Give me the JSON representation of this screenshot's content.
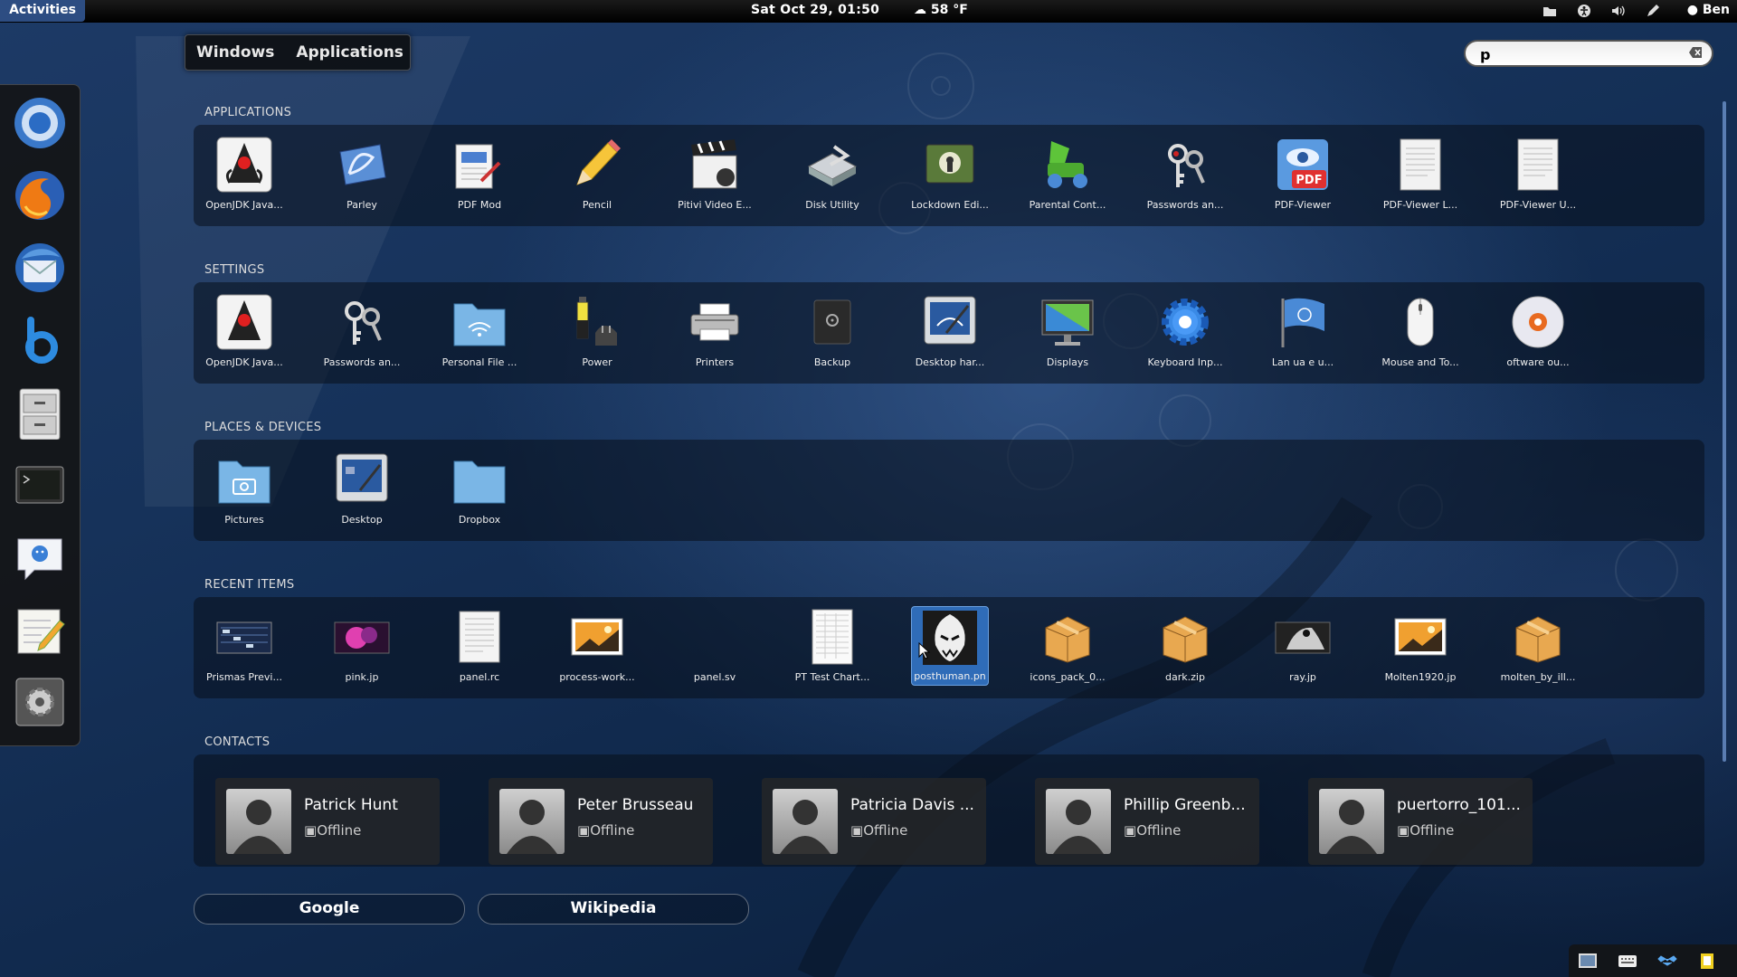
{
  "topbar": {
    "activities": "Activities",
    "clock": "Sat Oct 29, 01:50",
    "weather": "58 °F",
    "user": "Ben"
  },
  "view_selector": {
    "windows": "Windows",
    "applications": "Applications"
  },
  "search": {
    "value": "p"
  },
  "sections": {
    "applications": "APPLICATIONS",
    "settings": "SETTINGS",
    "places": "PLACES & DEVICES",
    "recent": "RECENT ITEMS",
    "contacts": "CONTACTS"
  },
  "applications": [
    {
      "label": "OpenJDK Java...",
      "icon": "java-duke-icon"
    },
    {
      "label": "Parley",
      "icon": "parley-icon"
    },
    {
      "label": "PDF Mod",
      "icon": "pdf-mod-icon"
    },
    {
      "label": "Pencil",
      "icon": "pencil-icon"
    },
    {
      "label": "Pitivi Video E...",
      "icon": "clapperboard-icon"
    },
    {
      "label": "Disk Utility",
      "icon": "disk-utility-icon"
    },
    {
      "label": "Lockdown Edi...",
      "icon": "lockdown-icon"
    },
    {
      "label": "Parental Cont...",
      "icon": "parental-control-icon"
    },
    {
      "label": "Passwords an...",
      "icon": "keys-icon"
    },
    {
      "label": "PDF-Viewer",
      "icon": "pdf-viewer-icon"
    },
    {
      "label": "PDF-Viewer L...",
      "icon": "document-icon"
    },
    {
      "label": "PDF-Viewer U...",
      "icon": "document-icon"
    }
  ],
  "settings": [
    {
      "label": "OpenJDK Java...",
      "icon": "java-duke-icon"
    },
    {
      "label": "Passwords an...",
      "icon": "keys-icon"
    },
    {
      "label": "Personal File ...",
      "icon": "shared-folder-icon"
    },
    {
      "label": "Power",
      "icon": "power-battery-icon"
    },
    {
      "label": "Printers",
      "icon": "printer-icon"
    },
    {
      "label": "Backup",
      "icon": "safe-icon"
    },
    {
      "label": "Desktop  har...",
      "icon": "desktop-sharing-icon"
    },
    {
      "label": "Displays",
      "icon": "display-icon"
    },
    {
      "label": "Keyboard Inp...",
      "icon": "gear-icon"
    },
    {
      "label": "Lan  ua  e   u...",
      "icon": "flag-icon"
    },
    {
      "label": "Mouse and To...",
      "icon": "mouse-icon"
    },
    {
      "label": "oftware   ou...",
      "icon": "software-sources-icon"
    }
  ],
  "places": [
    {
      "label": "Pictures",
      "icon": "pictures-folder-icon"
    },
    {
      "label": "Desktop",
      "icon": "desktop-icon"
    },
    {
      "label": "Dropbox",
      "icon": "folder-icon"
    }
  ],
  "recent": [
    {
      "label": "Prismas Previ...",
      "icon": "image-thumbnail-icon"
    },
    {
      "label": "pink.jp",
      "icon": "image-thumbnail-icon"
    },
    {
      "label": "panel.rc",
      "icon": "text-file-icon"
    },
    {
      "label": "process-work...",
      "icon": "image-file-icon"
    },
    {
      "label": "panel.sv",
      "icon": "blank-file-icon"
    },
    {
      "label": "PT Test Chart...",
      "icon": "spreadsheet-icon"
    },
    {
      "label": "posthuman.pn",
      "icon": "image-thumbnail-icon"
    },
    {
      "label": "icons_pack_0...",
      "icon": "archive-icon"
    },
    {
      "label": "dark.zip",
      "icon": "archive-icon"
    },
    {
      "label": "ray.jp",
      "icon": "image-thumbnail-icon"
    },
    {
      "label": "Molten1920.jp",
      "icon": "image-file-icon"
    },
    {
      "label": "molten_by_ill...",
      "icon": "archive-icon"
    }
  ],
  "contacts": [
    {
      "name": "Patrick Hunt",
      "status": "Offline"
    },
    {
      "name": "Peter Brusseau",
      "status": "Offline"
    },
    {
      "name": "Patricia Davis ...",
      "status": "Offline"
    },
    {
      "name": "Phillip Greenb...",
      "status": "Offline"
    },
    {
      "name": "puertorro_101...",
      "status": "Offline"
    }
  ],
  "providers": {
    "google": "Google",
    "wikipedia": "Wikipedia"
  },
  "dash": [
    "chromium-icon",
    "firefox-icon",
    "thunderbird-icon",
    "banshee-icon",
    "file-cabinet-icon",
    "terminal-icon",
    "empathy-chat-icon",
    "text-editor-icon",
    "system-settings-icon"
  ],
  "colors": {
    "activities_bg": "#2d4d82",
    "selected_tile": "#2f6cb8",
    "background": "#16325a"
  }
}
